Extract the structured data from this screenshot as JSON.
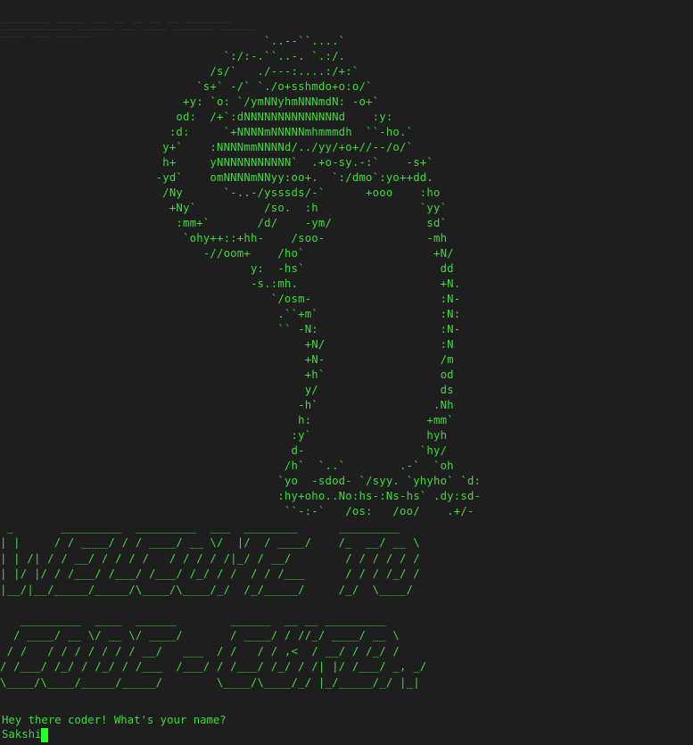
{
  "terminal": {
    "faded_scrollback": [
      "________ _____ ___ __ __ __ __ ________",
      "____________ ______ ___ ____ _______ ______",
      "____ ___ ______"
    ],
    "ascii_art": "                                       `..--``....`\n                                 `:/:-.``..-. `.:/.\n                               /s/`   ./---:....:/+:`\n                             `s+` -/` `./o+sshmdo+o:o/`\n                           +y: `o: `/ymNNyhmNNNmdN: -o+`\n                          od:  /+`:dNNNNNNNNNNNNNNd    :y:\n                         :d:     `+NNNNmNNNNNmhmmmdh  ``-ho.`\n                        y+`    :NNNNmmNNNNd/../yy/+o+//--/o/`\n                        h+     yNNNNNNNNNNN`  .+o-sy.-:`    -s+`\n                       -yd`    omNNNNmNNyy:oo+.  `:/dmo`:yo++dd.\n                        /Ny      `-..-/ysssds/-`      +ooo    :ho\n                         +Ny`          /so.  :h               `yy`\n                          :mm+`       /d/    -ym/              sd`\n                           `ohy++::+hh-    /soo-               -mh\n                              -//oom+    /ho`                   +N/\n                                     y:  -hs`                    dd\n                                     -s.:mh.                     +N.\n                                        `/osm-                   :N-\n                                         .``+m`                  :N:\n                                         `` -N:                  :N-\n                                             +N/                 :N\n                                             +N-                 /m\n                                             +h`                 od\n                                             y/                  ds\n                                            -h`                 .Nh\n                                            h:                 +mm`\n                                           :y`                 hyh\n                                           d-                 `hy/\n                                          /h`  `..`        .-`  `oh\n                                         `yo  -sdod- `/syy. `yhyho` `d:\n                                         :hy+oho..No:hs-:Ns-hs` .dy:sd-\n                                          ``-:-`   /os:   /oo/    .+/-",
    "banner_line1": [
      " _       _________  _________  ___  ________      _________",
      "| |     / / ____/ / / ____/ __ \\/  |/  / ____/    /_  __/ __ \\",
      "| | /| / / __/ / / / /   / / / / /|_/ / __/        / / / / / /",
      "| |/ |/ / /___/ /___/ /___/ /_/ / /  / / /___      / / / /_/ /",
      "|__/|__/_____/_____/\\____/\\____/_/  /_/_____/     /_/  \\____/"
    ],
    "banner_line2": [
      "   _________  ____  ______        ______  __ __ _________",
      "  / ____/ __ \\/ __ \\/ ____/       / ____/ / //_/ ____/ __ \\",
      " / /   / / / / / / / __/   ___  / /   / / ,<  / __/ / /_/ /",
      "/ /___/ /_/ / /_/ / /___  /___/ / /___/ /_/ / /| |/ /___/ _, _/",
      "\\____/\\____/_____/_____/        \\____/\\____/_/ |_/_____/_/ |_|"
    ],
    "prompt": "Hey there coder! What's your name?",
    "input_value": "Sakshi"
  },
  "colors": {
    "background": "#1e1e1e",
    "text": "#41d93f",
    "cursor": "#2bff2b"
  }
}
